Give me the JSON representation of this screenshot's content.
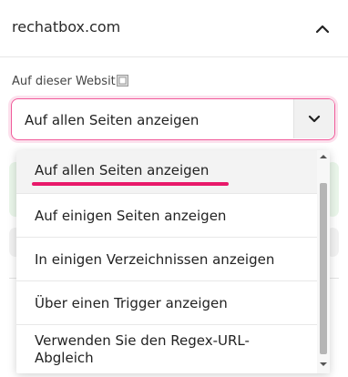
{
  "header": {
    "site_title": "rechatbox.com",
    "collapse_icon": "chevron-up-icon"
  },
  "field": {
    "label": "Auf dieser Websit",
    "info_icon": "info-icon"
  },
  "select": {
    "value": "Auf allen Seiten anzeigen",
    "arrow_icon": "chevron-down-icon"
  },
  "dropdown": {
    "options": [
      {
        "label": "Auf allen Seiten anzeigen",
        "selected": true
      },
      {
        "label": "Auf einigen Seiten anzeigen",
        "selected": false
      },
      {
        "label": "In einigen Verzeichnissen anzeigen",
        "selected": false
      },
      {
        "label": "Über einen Trigger anzeigen",
        "selected": false
      },
      {
        "label": "Verwenden Sie den Regex-URL-\nAbgleich",
        "selected": false
      }
    ],
    "option_line1": "Verwenden Sie den Regex-URL-",
    "option_line2": "Abgleich"
  },
  "colors": {
    "accent": "#f05b9a",
    "underline": "#e8196a",
    "selected_bg": "#f3f3f3",
    "peek_green": "#eaf6ea"
  }
}
